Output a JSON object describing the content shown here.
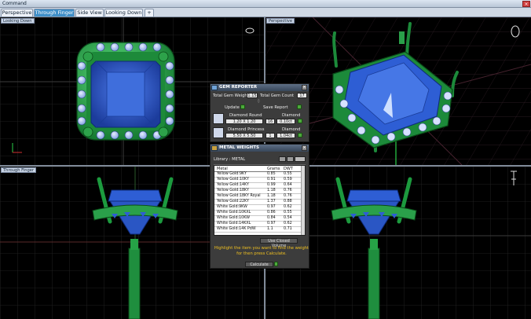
{
  "command_bar": {
    "label": "Command",
    "close_symbol": "×"
  },
  "tabs": [
    {
      "label": "Perspective"
    },
    {
      "label": "Through Finger"
    },
    {
      "label": "Side View"
    },
    {
      "label": "Looking Down"
    },
    {
      "label": "+"
    }
  ],
  "viewports": {
    "top_left": "Looking Down",
    "top_right": "Perspective",
    "bottom_left": "Through Finger",
    "bottom_right": ""
  },
  "gem_reporter": {
    "title": "GEM REPORTER",
    "total_weight_label": "Total Gem Weight",
    "total_weight_value": "1.15",
    "total_count_label": "Total Gem Count",
    "total_count_value": "17",
    "update_label": "Update",
    "save_report_label": "Save Report",
    "gems": [
      {
        "name": "Diamond Round",
        "size": "1.20 X 1.20",
        "type": "Diamond",
        "count": "16",
        "weight": "0.10ct"
      },
      {
        "name": "Diamond Princess",
        "size": "5.50 X 5.50",
        "type": "Diamond",
        "count": "1",
        "weight": "1.04ct"
      }
    ]
  },
  "metal_weights": {
    "title": "METAL WEIGHTS",
    "library_label": "Library : METAL",
    "columns": [
      "Metal",
      "Grams",
      "DWT"
    ],
    "rows": [
      [
        "Yellow Gold:9KY",
        "0.85",
        "0.55"
      ],
      [
        "Yellow Gold:10KY",
        "0.91",
        "0.59"
      ],
      [
        "Yellow Gold:14KY",
        "0.99",
        "0.64"
      ],
      [
        "Yellow Gold:18KY",
        "1.18",
        "0.76"
      ],
      [
        "Yellow Gold:18KY Royal",
        "1.18",
        "0.76"
      ],
      [
        "Yellow Gold:22KY",
        "1.37",
        "0.88"
      ],
      [
        "White Gold:9KW",
        "0.97",
        "0.62"
      ],
      [
        "White Gold:10KXL",
        "0.86",
        "0.55"
      ],
      [
        "White Gold:10KW",
        "0.84",
        "0.54"
      ],
      [
        "White Gold:14KXL",
        "0.97",
        "0.62"
      ],
      [
        "White Gold:14K PdW",
        "1.1",
        "0.71"
      ]
    ],
    "selector_label": "Use Closed Volume",
    "hint": "Highlight the item you want to find the weight for then press Calculate.",
    "calculate_label": "Calculate"
  }
}
